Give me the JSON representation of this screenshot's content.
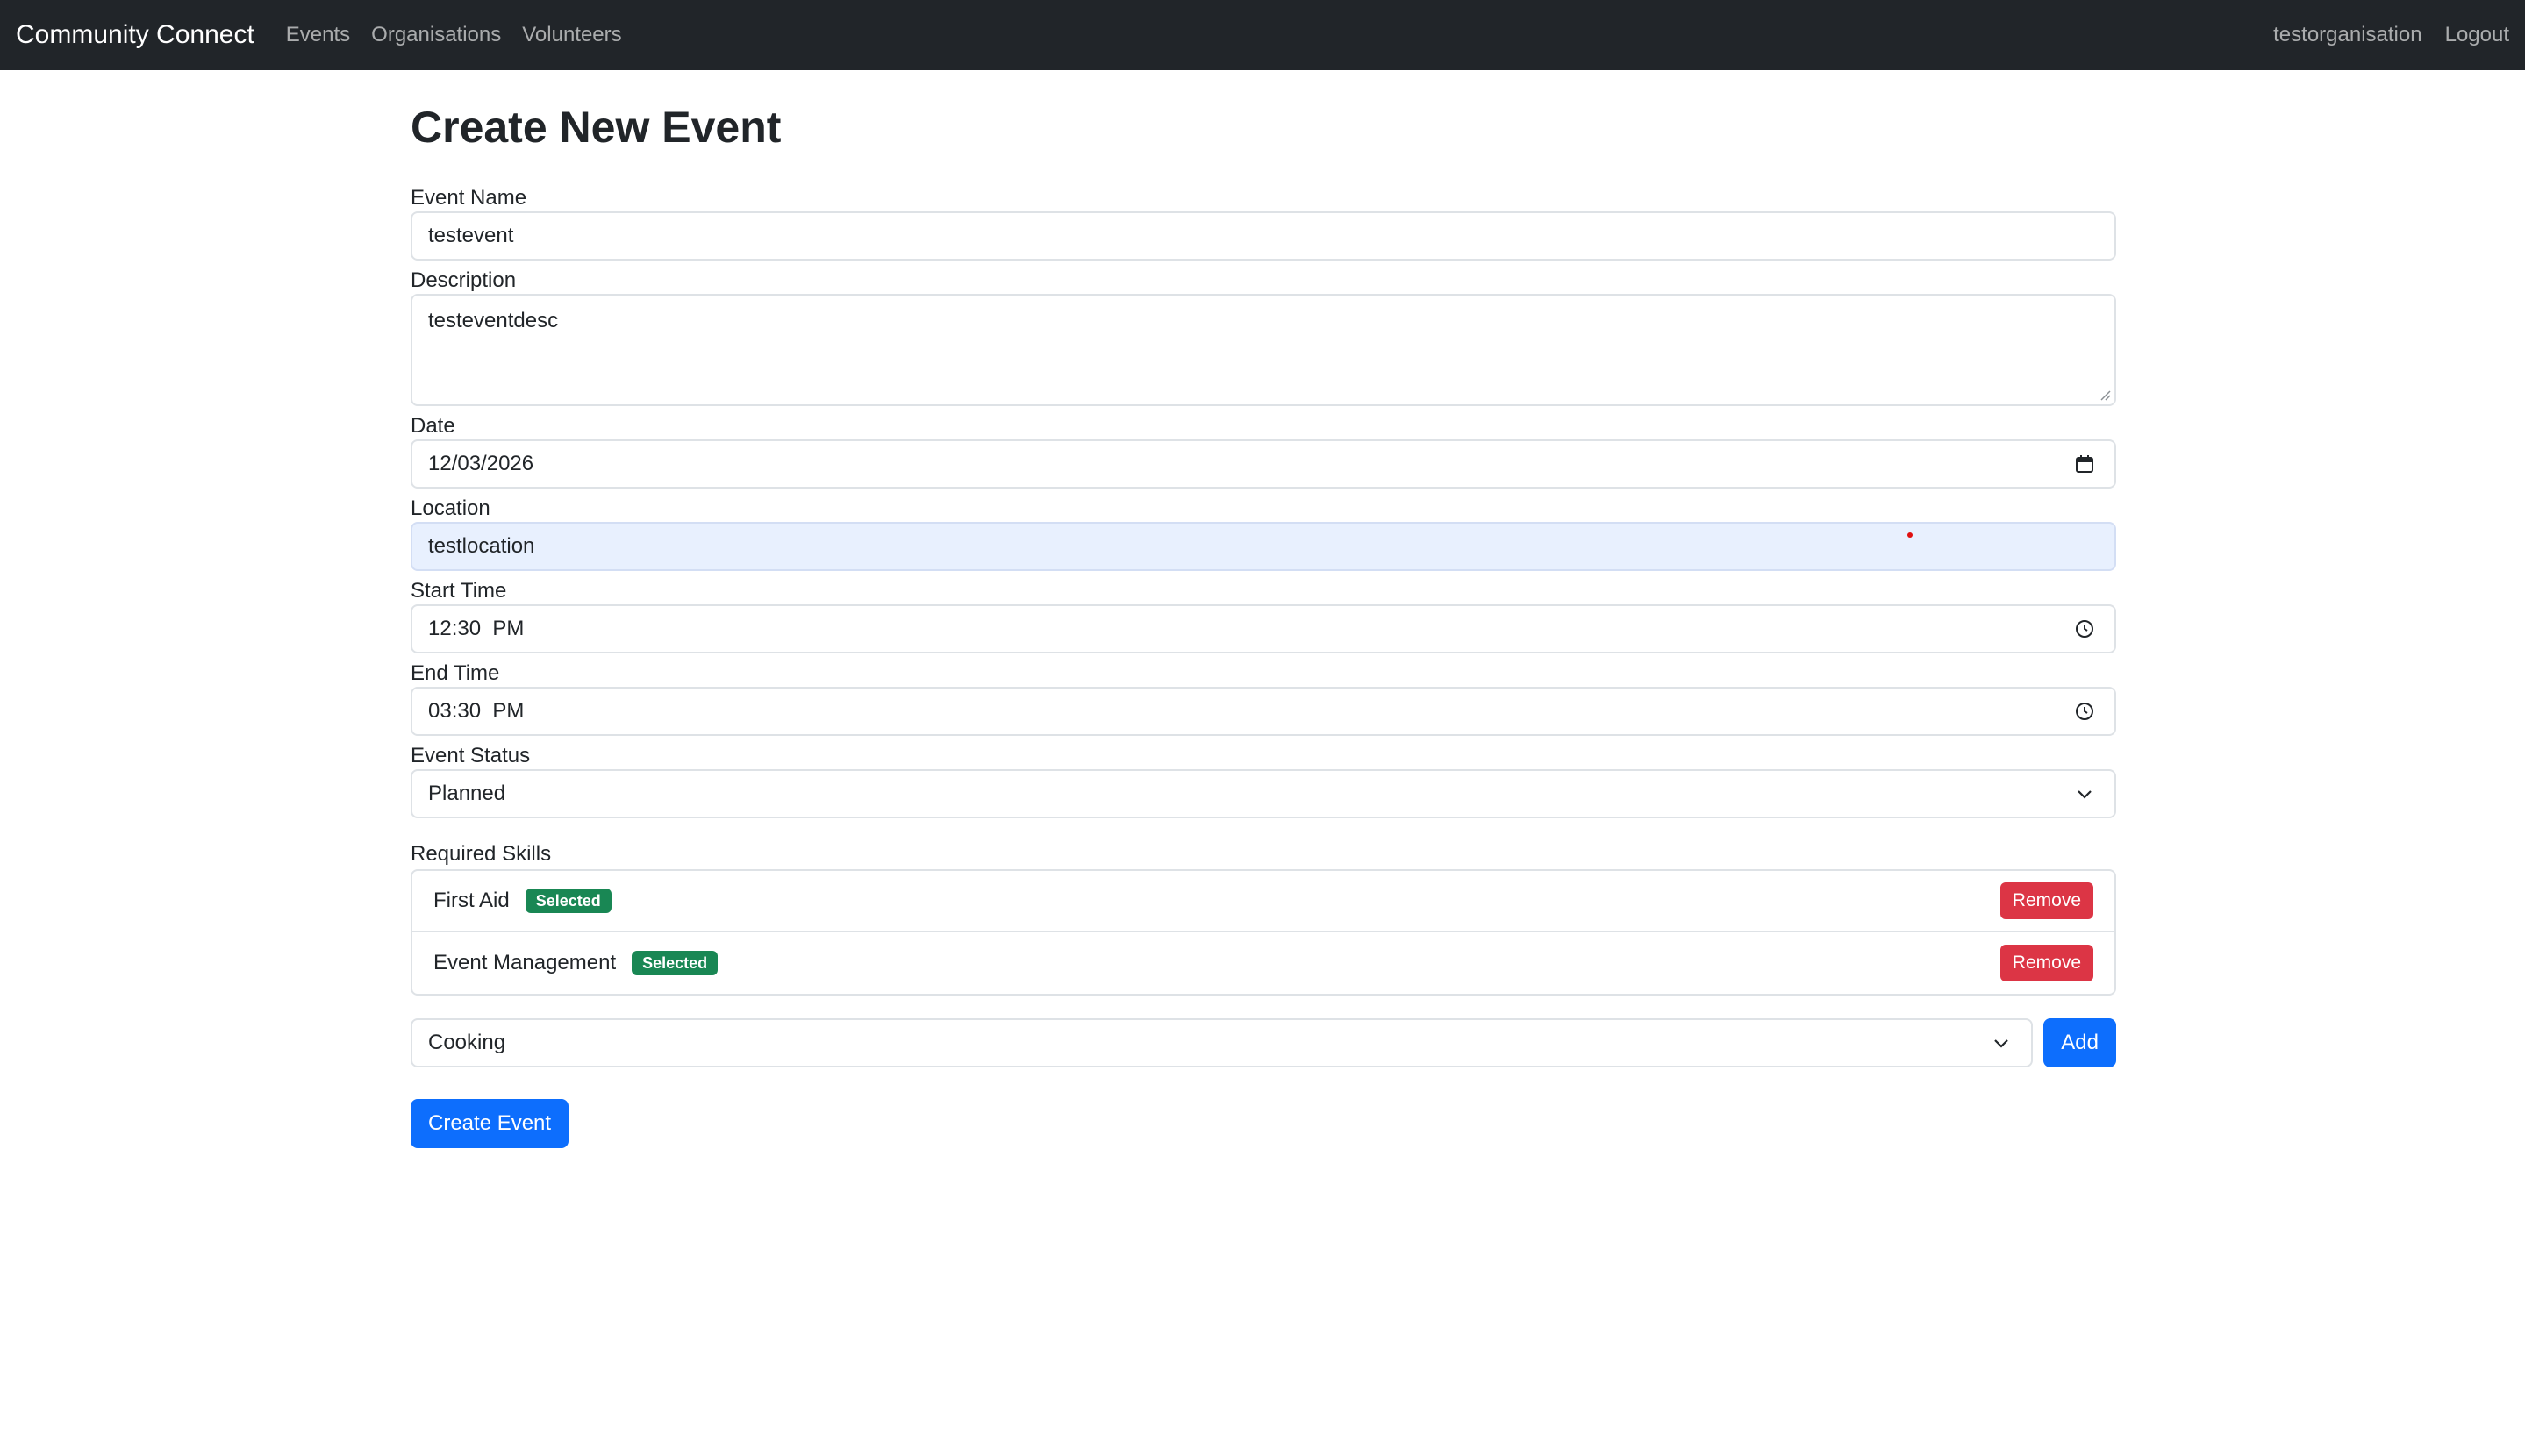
{
  "nav": {
    "brand": "Community Connect",
    "links": [
      "Events",
      "Organisations",
      "Volunteers"
    ],
    "user": "testorganisation",
    "logout": "Logout"
  },
  "page": {
    "title": "Create New Event"
  },
  "form": {
    "event_name": {
      "label": "Event Name",
      "value": "testevent"
    },
    "description": {
      "label": "Description",
      "value": "testeventdesc"
    },
    "date": {
      "label": "Date",
      "value": "12/03/2026",
      "icon": "calendar-icon"
    },
    "location": {
      "label": "Location",
      "value": "testlocation"
    },
    "start_time": {
      "label": "Start Time",
      "value": "12:30  PM",
      "icon": "clock-icon"
    },
    "end_time": {
      "label": "End Time",
      "value": "03:30  PM",
      "icon": "clock-icon"
    },
    "status": {
      "label": "Event Status",
      "value": "Planned"
    }
  },
  "skills": {
    "label": "Required Skills",
    "items": [
      {
        "name": "First Aid",
        "badge": "Selected",
        "action": "Remove"
      },
      {
        "name": "Event Management",
        "badge": "Selected",
        "action": "Remove"
      }
    ],
    "selector_value": "Cooking",
    "add_label": "Add"
  },
  "submit_label": "Create Event",
  "colors": {
    "navbar": "#212529",
    "primary": "#0d6efd",
    "danger": "#dc3545",
    "success": "#198754",
    "autofill": "#e8f0fe"
  }
}
